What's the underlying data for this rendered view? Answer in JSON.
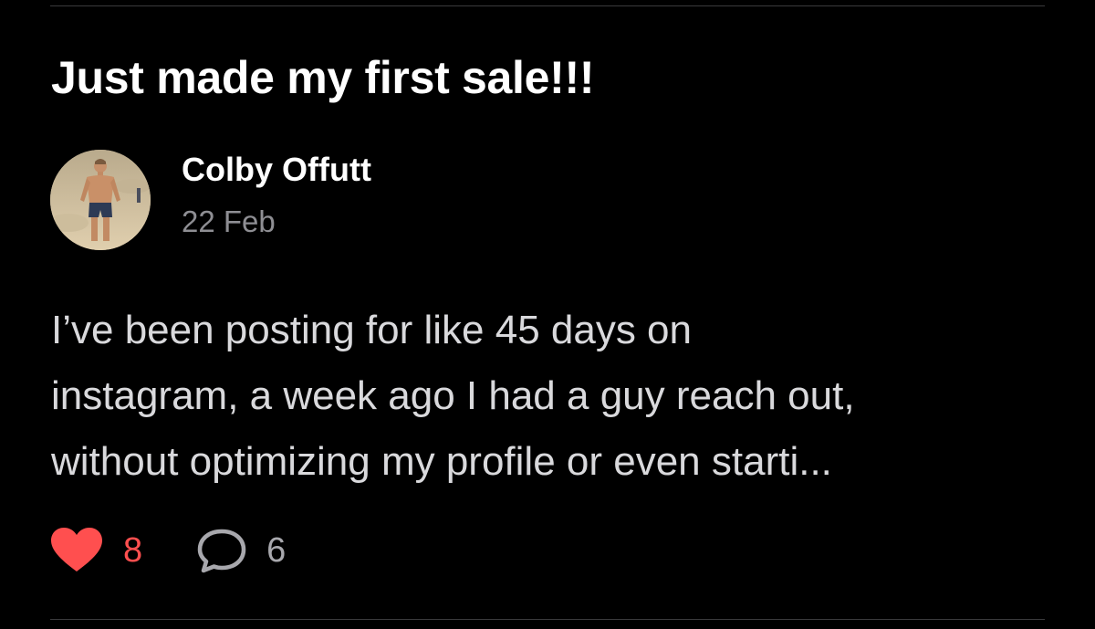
{
  "post": {
    "title": "Just made my first sale!!!",
    "author": {
      "name": "Colby Offutt",
      "date": "22 Feb"
    },
    "body": "I’ve been posting for like 45 days on\ninstagram, a week ago I had a guy reach out,\nwithout optimizing my profile or even starti...",
    "likes": {
      "count": "8",
      "icon": "heart-icon",
      "color": "#ff4f4f"
    },
    "comments": {
      "count": "6",
      "icon": "comment-bubble-icon",
      "color": "#a8a8ad"
    }
  },
  "theme": {
    "background": "#000000",
    "divider": "#3a3a3c",
    "secondary_text": "#8e8e93"
  }
}
